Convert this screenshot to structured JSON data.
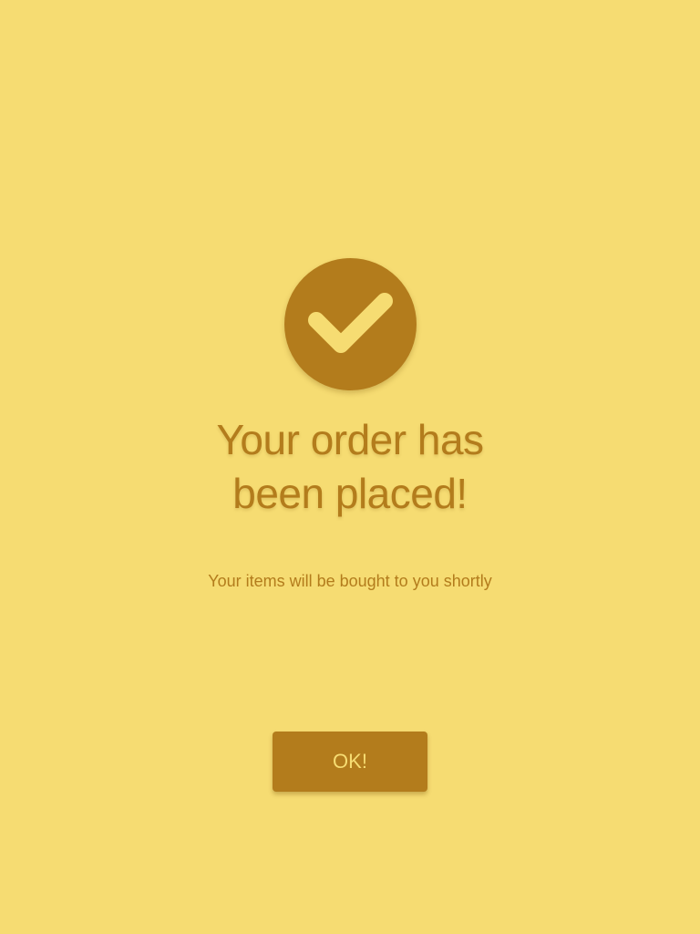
{
  "confirmation": {
    "icon": "checkmark-icon",
    "title": "Your order has been placed!",
    "message": "Your items will be bought to you shortly",
    "ok_label": "OK!"
  },
  "colors": {
    "background": "#F6DC72",
    "accent": "#B37C1C"
  }
}
